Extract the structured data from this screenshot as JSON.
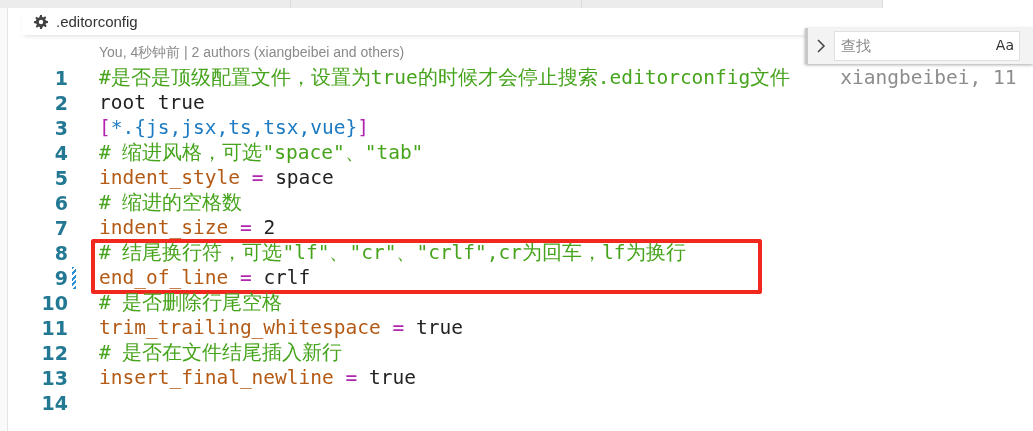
{
  "breadcrumb": {
    "file": ".editorconfig"
  },
  "blame_header": "You, 4秒钟前 | 2 authors (xiangbeibei and others)",
  "lines": [
    {
      "number": "1",
      "boxed": false,
      "modified": false,
      "tokens": [
        {
          "kind": "comment",
          "text": "#是否是顶级配置文件，设置为true的时候才会停止搜索.editorconfig文件"
        }
      ],
      "blame": "xiangbeibei, 11"
    },
    {
      "number": "2",
      "boxed": false,
      "modified": false,
      "tokens": [
        {
          "kind": "value",
          "text": "root true"
        }
      ]
    },
    {
      "number": "3",
      "boxed": false,
      "modified": false,
      "tokens": [
        {
          "kind": "bracket",
          "text": "["
        },
        {
          "kind": "section",
          "text": "*.{js,jsx,ts,tsx,vue}"
        },
        {
          "kind": "bracket",
          "text": "]"
        }
      ]
    },
    {
      "number": "4",
      "boxed": false,
      "modified": false,
      "tokens": [
        {
          "kind": "comment",
          "text": "# 缩进风格，可选\"space\"、\"tab\""
        }
      ]
    },
    {
      "number": "5",
      "boxed": false,
      "modified": false,
      "tokens": [
        {
          "kind": "key",
          "text": "indent_style"
        },
        {
          "kind": "operator",
          "text": " = "
        },
        {
          "kind": "value",
          "text": "space"
        }
      ]
    },
    {
      "number": "6",
      "boxed": false,
      "modified": false,
      "tokens": [
        {
          "kind": "comment",
          "text": "# 缩进的空格数"
        }
      ]
    },
    {
      "number": "7",
      "boxed": false,
      "modified": false,
      "tokens": [
        {
          "kind": "key",
          "text": "indent_size"
        },
        {
          "kind": "operator",
          "text": " = "
        },
        {
          "kind": "value",
          "text": "2"
        }
      ]
    },
    {
      "number": "8",
      "boxed": true,
      "modified": false,
      "tokens": [
        {
          "kind": "comment",
          "text": "# 结尾换行符，可选\"lf\"、\"cr\"、\"crlf\",cr为回车，lf为换行"
        }
      ]
    },
    {
      "number": "9",
      "boxed": true,
      "modified": true,
      "tokens": [
        {
          "kind": "key",
          "text": "end_of_line"
        },
        {
          "kind": "operator",
          "text": " = "
        },
        {
          "kind": "value",
          "text": "crlf"
        }
      ]
    },
    {
      "number": "10",
      "boxed": false,
      "modified": false,
      "tokens": [
        {
          "kind": "comment",
          "text": "# 是否删除行尾空格"
        }
      ]
    },
    {
      "number": "11",
      "boxed": false,
      "modified": false,
      "tokens": [
        {
          "kind": "key",
          "text": "trim_trailing_whitespace"
        },
        {
          "kind": "operator",
          "text": " = "
        },
        {
          "kind": "value",
          "text": "true"
        }
      ]
    },
    {
      "number": "12",
      "boxed": false,
      "modified": false,
      "tokens": [
        {
          "kind": "comment",
          "text": "# 是否在文件结尾插入新行"
        }
      ]
    },
    {
      "number": "13",
      "boxed": false,
      "modified": false,
      "tokens": [
        {
          "kind": "key",
          "text": "insert_final_newline"
        },
        {
          "kind": "operator",
          "text": " = "
        },
        {
          "kind": "value",
          "text": "true"
        }
      ]
    },
    {
      "number": "14",
      "boxed": false,
      "modified": false
    }
  ],
  "find_widget": {
    "placeholder": "查找",
    "case_toggle": "Aa"
  }
}
